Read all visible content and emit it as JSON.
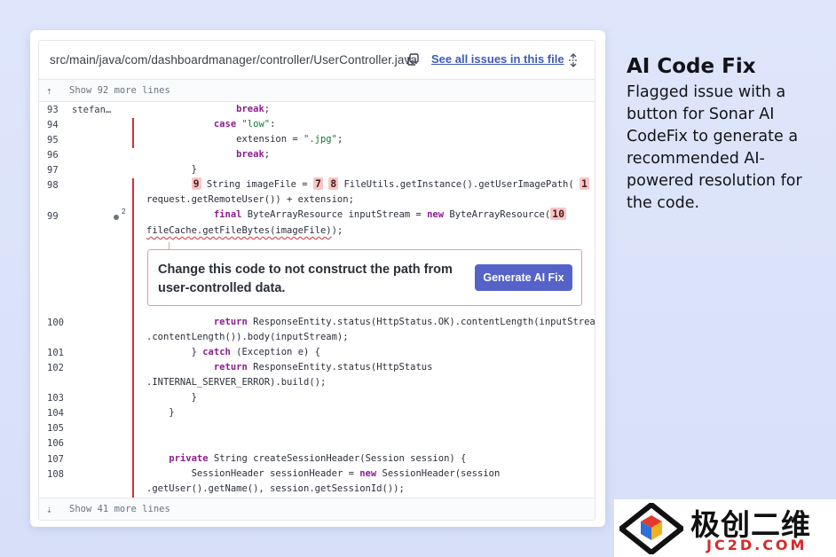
{
  "file": {
    "path": "src/main/java/com/dashboardmanager/controller/UserController.java",
    "see_all_label": "See all issues in this file"
  },
  "expand_top": {
    "label": "Show 92 more lines"
  },
  "expand_bottom": {
    "label": "Show 41 more lines"
  },
  "code": {
    "author_93": "stefan…",
    "line_numbers": [
      "93",
      "94",
      "95",
      "96",
      "97",
      "98",
      "99",
      "100",
      "101",
      "102",
      "103",
      "104",
      "105",
      "106",
      "107",
      "108"
    ],
    "issue_count_99": "2",
    "markers": {
      "m9": "9",
      "m7": "7",
      "m8": "8",
      "m1": "1",
      "m10": "10"
    },
    "lines": {
      "l93_kw": "break",
      "l93_rest": ";",
      "l94_kw": "case",
      "l94_str": "\"low\"",
      "l94_rest": ":",
      "l95_a": "extension = ",
      "l95_str": "\".jpg\"",
      "l95_b": ";",
      "l96_kw": "break",
      "l96_rest": ";",
      "l97": "}",
      "l98_a": " String imageFile = ",
      "l98_b": " FileUtils.getInstance().getUserImagePath( ",
      "l98_c": "request.getRemoteUser()) + extension;",
      "l99_kw1": "final",
      "l99_a": " ByteArrayResource inputStream = ",
      "l99_kw2": "new",
      "l99_b": " ByteArrayResource(",
      "l99_c": "fileCache.getFileBytes(imageFile)",
      "l99_d": ");",
      "l100_kw": "return",
      "l100_a": " ResponseEntity.status(HttpStatus.OK).contentLength(inputStream",
      "l100_b": ".contentLength()).body(inputStream);",
      "l101_a": "} ",
      "l101_kw": "catch",
      "l101_b": " (Exception e) {",
      "l102_kw": "return",
      "l102_a": " ResponseEntity.status(HttpStatus",
      "l102_b": ".INTERNAL_SERVER_ERROR).build();",
      "l103": "}",
      "l104": "}",
      "l107_kw": "private",
      "l107_a": " String createSessionHeader(Session session) {",
      "l108_a": "SessionHeader sessionHeader = ",
      "l108_kw": "new",
      "l108_b": " SessionHeader(session",
      "l108_c": ".getUser().getName(), session.getSessionId());"
    }
  },
  "issue": {
    "message": "Change this code to not construct the path from user-controlled data.",
    "button_label": "Generate AI Fix"
  },
  "side": {
    "title": "AI Code Fix",
    "description": "Flagged issue with a button for Sonar AI CodeFix to generate a recommended AI-powered resolution for the code."
  },
  "watermark": {
    "cn": "极创二维",
    "en": "JC2D.COM"
  },
  "colors": {
    "accent": "#5563c8",
    "link": "#3d5bb5",
    "issue_bar": "#d02f3a",
    "marker": "#f9c6c6"
  }
}
